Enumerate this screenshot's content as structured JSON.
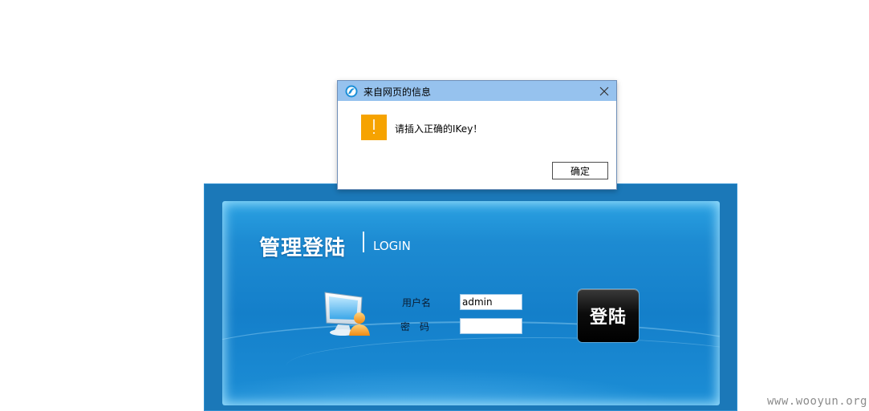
{
  "login": {
    "title_cn": "管理登陆",
    "title_en": "LOGIN",
    "username_label": "用户名",
    "password_label": "密　码",
    "username_value": "admin",
    "password_value": "",
    "submit_label": "登陆",
    "monitor_icon": "user-monitor-icon"
  },
  "dialog": {
    "title": "来自网页的信息",
    "message": "请插入正确的IKey！",
    "ok_label": "确定",
    "warning_icon": "warning-icon",
    "close_icon": "close-icon"
  },
  "watermark": "www.wooyun.org",
  "colors": {
    "panel_blue": "#147fca",
    "outer_blue": "#1b78b8",
    "dialog_titlebar": "#96c2ee",
    "warning_orange": "#f6a300"
  }
}
